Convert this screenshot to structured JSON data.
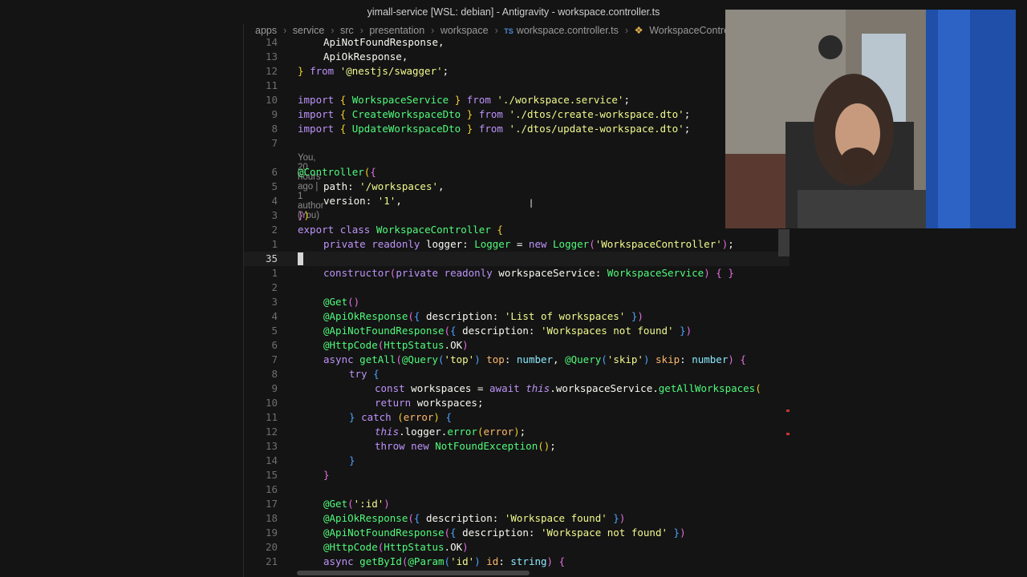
{
  "window": {
    "title": "yimall-service [WSL: debian] - Antigravity - workspace.controller.ts"
  },
  "breadcrumb": {
    "items": [
      "apps",
      "service",
      "src",
      "presentation",
      "workspace",
      "workspace.controller.ts",
      "WorkspaceController"
    ],
    "lang_badge": "TS"
  },
  "codelens": {
    "text": "You, 20 hours ago | 1 author (You)"
  },
  "line_numbers": [
    "14",
    "13",
    "12",
    "11",
    "10",
    "9",
    "8",
    "7",
    "6",
    "5",
    "4",
    "3",
    "2",
    "1",
    "35",
    "1",
    "2",
    "3",
    "4",
    "5",
    "6",
    "7",
    "8",
    "9",
    "10",
    "11",
    "12",
    "13",
    "14",
    "15",
    "16",
    "17",
    "18",
    "19",
    "20",
    "21"
  ],
  "code": {
    "l14": "ApiNotFoundResponse,",
    "l13": "ApiOkResponse,",
    "l12_a": "}",
    "l12_b": "from",
    "l12_c": "'@nestjs/swagger'",
    "import_kw": "import",
    "from_kw": "from",
    "l10_name": "WorkspaceService",
    "l10_path": "'./workspace.service'",
    "l9_name": "CreateWorkspaceDto",
    "l9_path": "'./dtos/create-workspace.dto'",
    "l8_name": "UpdateWorkspaceDto",
    "l8_path": "'./dtos/update-workspace.dto'",
    "l6": "@Controller",
    "l5_key": "path",
    "l5_val": "'/workspaces'",
    "l4_key": "version",
    "l4_val": "'1'",
    "export_kw": "export",
    "class_kw": "class",
    "class_name": "WorkspaceController",
    "private_kw": "private",
    "readonly_kw": "readonly",
    "logger": "logger",
    "logger_type": "Logger",
    "new_kw": "new",
    "logger_arg": "'WorkspaceController'",
    "ctor": "constructor",
    "svc": "workspaceService",
    "svc_type": "WorkspaceService",
    "get": "@Get",
    "api_ok": "@ApiOkResponse",
    "api_nf": "@ApiNotFoundResponse",
    "http_code": "@HttpCode",
    "http_status": "HttpStatus",
    "ok": "OK",
    "desc": "description",
    "desc_list": "'List of workspaces'",
    "desc_nf_list": "'Workspaces not found'",
    "async_kw": "async",
    "getAll": "getAll",
    "query": "@Query",
    "top_s": "'top'",
    "top": "top",
    "number": "number",
    "skip_s": "'skip'",
    "skip": "skip",
    "try_kw": "try",
    "const_kw": "const",
    "workspaces": "workspaces",
    "await_kw": "await",
    "this_kw": "this",
    "getAllWs": "getAllWorkspaces",
    "return_kw": "return",
    "catch_kw": "catch",
    "error": "error",
    "logger_error": "error",
    "throw_kw": "throw",
    "nfe": "NotFoundException",
    "id_s": "':id'",
    "desc_found": "'Workspace found'",
    "desc_nf": "'Workspace not found'",
    "getById": "getById",
    "param": "@Param",
    "id_q": "'id'",
    "id": "id",
    "string": "string"
  },
  "colors": {
    "background": "#141414",
    "keyword": "#bd93f9",
    "function": "#50fa7b",
    "string": "#f1fa8c"
  }
}
